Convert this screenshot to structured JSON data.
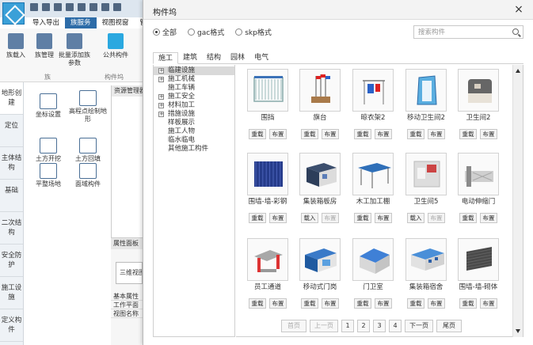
{
  "app": {
    "ribbon_tabs": [
      "导入导出",
      "族服务",
      "视图视窗",
      "管"
    ],
    "active_ribbon_tab": "族服务",
    "ribbon_buttons": [
      {
        "label": "族载入",
        "icon": "family-load-icon"
      },
      {
        "label": "族管理",
        "icon": "family-manage-icon"
      },
      {
        "label": "批量添加族参数",
        "icon": "batch-param-icon"
      },
      {
        "label": "公共构件",
        "icon": "gac-icon"
      }
    ],
    "ribbon_groups": [
      "族",
      "构件坞"
    ],
    "left_nav": [
      "地形创建",
      "定位",
      "主体结构",
      "基础",
      "二次结构",
      "安全防护",
      "施工设施",
      "定义构件"
    ],
    "tools": [
      {
        "label": "坐标设置"
      },
      {
        "label": "高程点绘制地形"
      },
      {
        "label": "土方开挖"
      },
      {
        "label": "土方回填"
      },
      {
        "label": "平整场地"
      },
      {
        "label": "面域构件"
      }
    ],
    "resource_panel_title": "资源管理器",
    "property_panel_title": "属性面板",
    "property_view": "三维视图",
    "property_rows": [
      "基本属性",
      "工作平面",
      "视图名称"
    ]
  },
  "dialog": {
    "title": "构件坞",
    "close_icon": "×",
    "filters": [
      {
        "label": "全部",
        "selected": true
      },
      {
        "label": "gac格式",
        "selected": false
      },
      {
        "label": "skp格式",
        "selected": false
      }
    ],
    "search_placeholder": "搜索构件",
    "tabs": [
      "施工",
      "建筑",
      "结构",
      "园林",
      "电气"
    ],
    "active_tab": "施工",
    "tree": [
      {
        "label": "临建设施",
        "expandable": true,
        "selected": true
      },
      {
        "label": "施工机械",
        "expandable": true,
        "selected": false
      },
      {
        "label": "施工车辆",
        "expandable": false,
        "selected": false
      },
      {
        "label": "施工安全",
        "expandable": true,
        "selected": false
      },
      {
        "label": "材料加工",
        "expandable": true,
        "selected": false
      },
      {
        "label": "措施设施",
        "expandable": true,
        "selected": false
      },
      {
        "label": "样板展示",
        "expandable": false,
        "selected": false
      },
      {
        "label": "施工人物",
        "expandable": false,
        "selected": false
      },
      {
        "label": "临水临电",
        "expandable": false,
        "selected": false
      },
      {
        "label": "其他施工构件",
        "expandable": false,
        "selected": false
      }
    ],
    "components": [
      {
        "name": "围挡",
        "btn1": "重载",
        "btn2": "布置",
        "btn1_enabled": true
      },
      {
        "name": "旗台",
        "btn1": "重载",
        "btn2": "布置",
        "btn1_enabled": true
      },
      {
        "name": "晾衣架2",
        "btn1": "重载",
        "btn2": "布置",
        "btn1_enabled": true
      },
      {
        "name": "移动卫生间2",
        "btn1": "重载",
        "btn2": "布置",
        "btn1_enabled": true
      },
      {
        "name": "卫生间2",
        "btn1": "重载",
        "btn2": "布置",
        "btn1_enabled": true
      },
      {
        "name": "围墙-墙-彩钢",
        "btn1": "重载",
        "btn2": "布置",
        "btn1_enabled": true
      },
      {
        "name": "集装箱板房",
        "btn1": "载入",
        "btn2": "布置",
        "btn1_enabled": false
      },
      {
        "name": "木工加工棚",
        "btn1": "重载",
        "btn2": "布置",
        "btn1_enabled": true
      },
      {
        "name": "卫生间5",
        "btn1": "载入",
        "btn2": "布置",
        "btn1_enabled": false
      },
      {
        "name": "电动伸缩门",
        "btn1": "重载",
        "btn2": "布置",
        "btn1_enabled": true
      },
      {
        "name": "员工通道",
        "btn1": "重载",
        "btn2": "布置",
        "btn1_enabled": true
      },
      {
        "name": "移动式门岗",
        "btn1": "重载",
        "btn2": "布置",
        "btn1_enabled": true
      },
      {
        "name": "门卫室",
        "btn1": "重载",
        "btn2": "布置",
        "btn1_enabled": true
      },
      {
        "name": "集装箱宿舍",
        "btn1": "重载",
        "btn2": "布置",
        "btn1_enabled": true
      },
      {
        "name": "围墙-墙-砌体",
        "btn1": "重载",
        "btn2": "布置",
        "btn1_enabled": true
      }
    ],
    "pagination": {
      "first": "首页",
      "prev": "上一页",
      "pages": [
        "1",
        "2",
        "3",
        "4"
      ],
      "next": "下一页",
      "last": "尾页"
    }
  }
}
